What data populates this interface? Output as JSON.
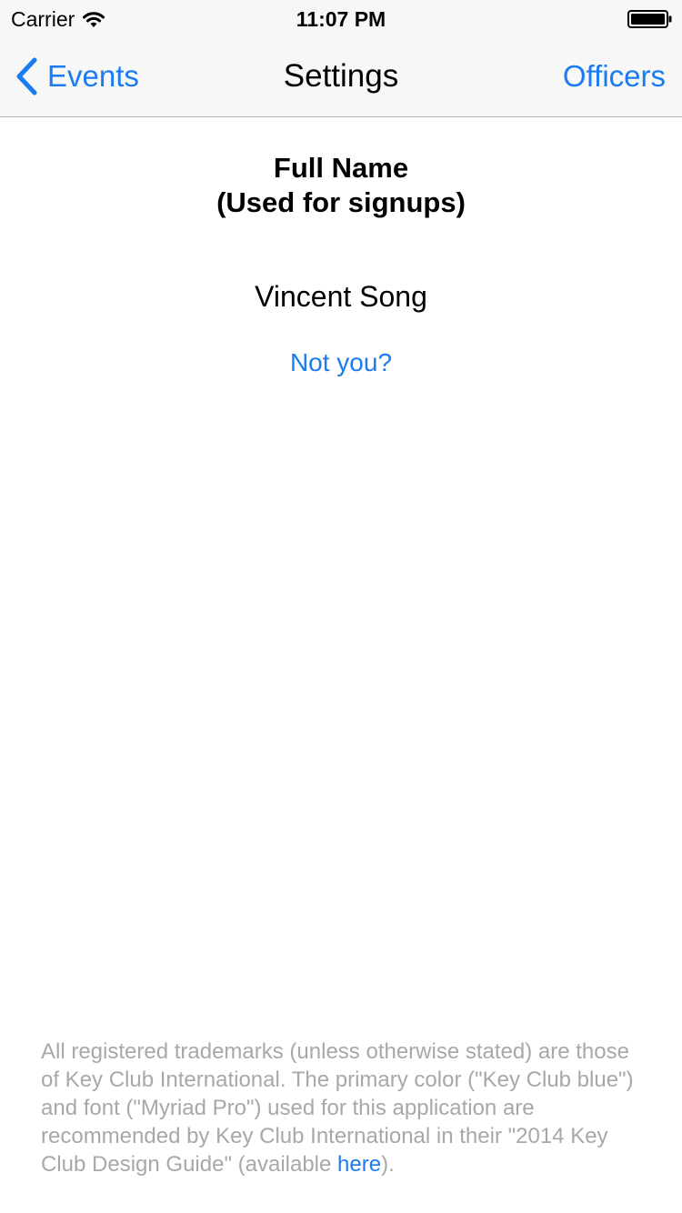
{
  "status_bar": {
    "carrier": "Carrier",
    "time": "11:07 PM",
    "wifi_icon": "wifi-icon",
    "battery_icon": "battery-icon"
  },
  "nav": {
    "back_label": "Events",
    "back_icon": "chevron-left-icon",
    "title": "Settings",
    "right_label": "Officers"
  },
  "profile": {
    "heading_line1": "Full Name",
    "heading_line2": "(Used for signups)",
    "name": "Vincent Song",
    "not_you_label": "Not you?"
  },
  "footer": {
    "legal_text": "All registered trademarks (unless otherwise stated) are those of Key Club International. The primary color (\"Key Club blue\") and font (\"Myriad Pro\") used for this application are recommended by Key Club International in their \"2014 Key Club Design Guide\" (available ",
    "link_label": "here",
    "legal_text_end": ")."
  },
  "colors": {
    "accent": "#1a7cf0",
    "bar_background": "#f7f7f7",
    "legal_text": "#a8a8a8"
  }
}
